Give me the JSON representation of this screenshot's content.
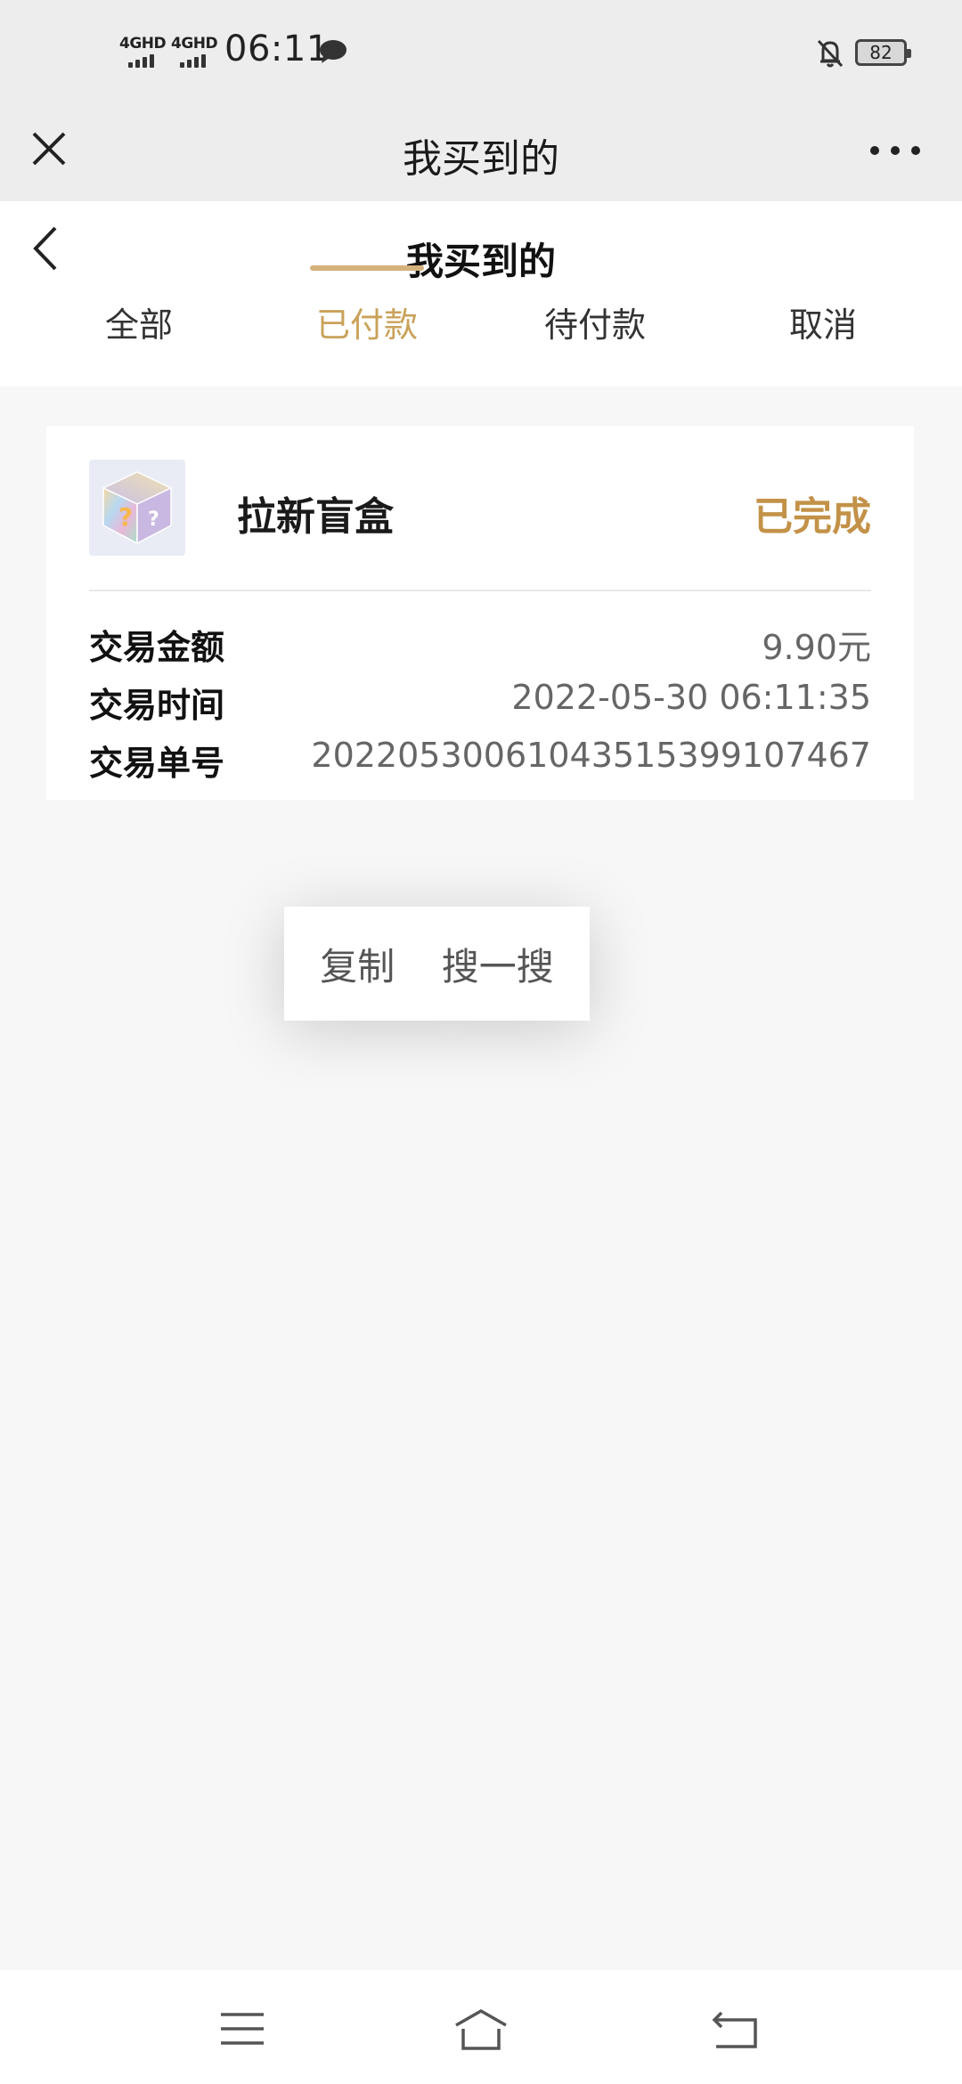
{
  "status_bar": {
    "sim1": "4GHD",
    "sim2": "4GHD",
    "time": "06:11",
    "battery": "82",
    "icons": [
      "signal-icon",
      "message-icon",
      "bell-off-icon",
      "battery-icon"
    ]
  },
  "navbar": {
    "title": "我买到的",
    "icons": [
      "close-icon",
      "more-icon"
    ]
  },
  "page": {
    "title": "我买到的",
    "tabs": [
      {
        "label": "全部",
        "active": false
      },
      {
        "label": "已付款",
        "active": true
      },
      {
        "label": "待付款",
        "active": false
      },
      {
        "label": "取消",
        "active": false
      }
    ],
    "accent_color": "#c9a25a"
  },
  "order": {
    "item_name": "拉新盲盒",
    "status": "已完成",
    "status_color": "#c39248",
    "image": "mystery-box-icon",
    "rows": [
      {
        "label": "交易金额",
        "value": "9.90元"
      },
      {
        "label": "交易时间",
        "value": "2022-05-30 06:11:35"
      },
      {
        "label": "交易单号",
        "value": "2022053006104351539910746​7"
      }
    ]
  },
  "context_menu": {
    "options": [
      "复制",
      "搜一搜"
    ]
  },
  "bottom_nav": {
    "icons": [
      "menu-icon",
      "home-icon",
      "back-icon"
    ]
  }
}
